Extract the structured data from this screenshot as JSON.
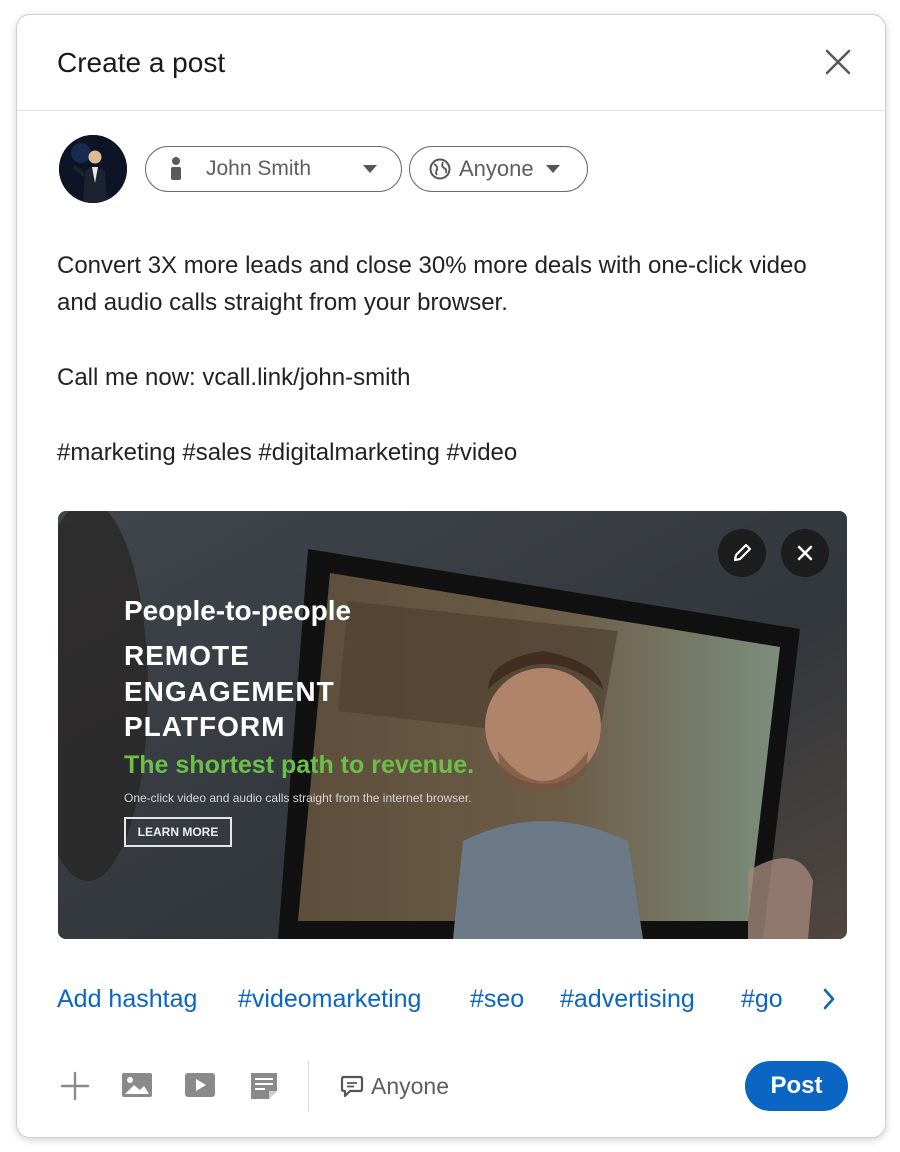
{
  "dialog": {
    "title": "Create a post"
  },
  "composer": {
    "author_name": "John Smith",
    "visibility": "Anyone",
    "post_lines": [
      "Convert 3X more leads and close 30% more deals with one-click video and audio calls straight from your browser.",
      "Call me now: vcall.link/john-smith",
      "#marketing #sales #digitalmarketing #video"
    ]
  },
  "preview": {
    "headline": "People-to-people",
    "line1": "REMOTE",
    "line2": "ENGAGEMENT",
    "line3": "PLATFORM",
    "tagline": "The shortest path to revenue.",
    "subtext": "One-click video and audio calls straight from the internet browser.",
    "cta": "LEARN MORE"
  },
  "hashtags": {
    "add_label": "Add hashtag",
    "items": [
      "#videomarketing",
      "#seo",
      "#advertising",
      "#go"
    ]
  },
  "toolbar": {
    "comment_visibility": "Anyone",
    "post_label": "Post"
  },
  "colors": {
    "accent": "#0a66c2",
    "tagline_green": "#6cc04a"
  },
  "icons": [
    "close-icon",
    "person-icon",
    "globe-icon",
    "plus-icon",
    "photo-icon",
    "video-icon",
    "document-icon",
    "comment-icon",
    "pencil-icon",
    "chevron-right-icon"
  ]
}
